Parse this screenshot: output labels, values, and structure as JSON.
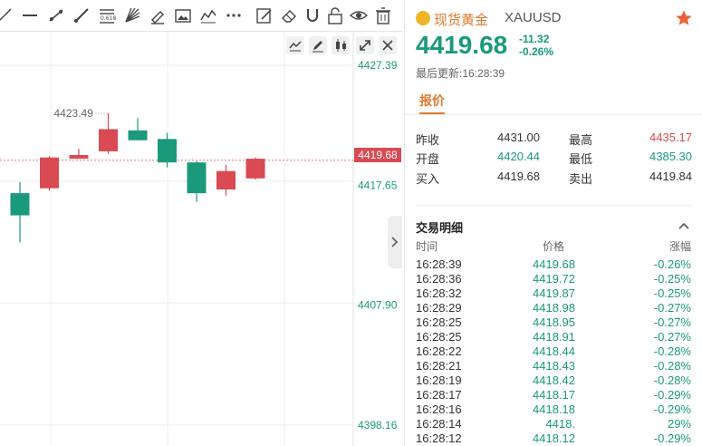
{
  "chart": {
    "price_axis": [
      "4427.39",
      "4417.65",
      "4407.90",
      "4398.16"
    ],
    "current_price_tag": "4419.68",
    "high_marker": "4423.49",
    "candles": [
      {
        "o": 4417.0,
        "h": 4417.9,
        "l": 4413.0,
        "c": 4415.2,
        "dir": "down"
      },
      {
        "o": 4417.4,
        "h": 4420.0,
        "l": 4417.2,
        "c": 4419.9,
        "dir": "up"
      },
      {
        "o": 4420.1,
        "h": 4420.6,
        "l": 4419.8,
        "c": 4419.8,
        "dir": "up"
      },
      {
        "o": 4420.4,
        "h": 4423.5,
        "l": 4420.2,
        "c": 4422.2,
        "dir": "up"
      },
      {
        "o": 4422.1,
        "h": 4423.1,
        "l": 4421.3,
        "c": 4421.3,
        "dir": "down"
      },
      {
        "o": 4421.4,
        "h": 4421.9,
        "l": 4419.1,
        "c": 4419.5,
        "dir": "down"
      },
      {
        "o": 4419.5,
        "h": 4419.6,
        "l": 4416.3,
        "c": 4417.0,
        "dir": "down"
      },
      {
        "o": 4417.3,
        "h": 4419.3,
        "l": 4416.8,
        "c": 4418.8,
        "dir": "up"
      },
      {
        "o": 4418.2,
        "h": 4419.9,
        "l": 4418.1,
        "c": 4419.8,
        "dir": "up"
      }
    ]
  },
  "quote": {
    "symbol_cn": "现货黄金",
    "symbol_code": "XAUUSD",
    "last_price": "4419.68",
    "change_abs": "-11.32",
    "change_pct": "-0.26%",
    "update_time": "最后更新:16:28:39",
    "tab": "报价",
    "stats": {
      "prev_close_label": "昨收",
      "prev_close": "4431.00",
      "high_label": "最高",
      "high": "4435.17",
      "open_label": "开盘",
      "open": "4420.44",
      "low_label": "最低",
      "low": "4385.30",
      "bid_label": "买入",
      "bid": "4419.68",
      "ask_label": "卖出",
      "ask": "4419.84"
    },
    "colors": {
      "up": "#d94a52",
      "down": "#1a9a7a",
      "accent": "#e0782e"
    }
  },
  "trades": {
    "title": "交易明细",
    "headers": [
      "时间",
      "价格",
      "涨幅"
    ],
    "rows": [
      {
        "time": "16:28:39",
        "price": "4419.68",
        "pct": "-0.26%"
      },
      {
        "time": "16:28:36",
        "price": "4419.72",
        "pct": "-0.25%"
      },
      {
        "time": "16:28:32",
        "price": "4419.87",
        "pct": "-0.25%"
      },
      {
        "time": "16:28:29",
        "price": "4418.98",
        "pct": "-0.27%"
      },
      {
        "time": "16:28:25",
        "price": "4418.95",
        "pct": "-0.27%"
      },
      {
        "time": "16:28:25",
        "price": "4418.91",
        "pct": "-0.27%"
      },
      {
        "time": "16:28:22",
        "price": "4418.44",
        "pct": "-0.28%"
      },
      {
        "time": "16:28:21",
        "price": "4418.43",
        "pct": "-0.28%"
      },
      {
        "time": "16:28:19",
        "price": "4418.42",
        "pct": "-0.28%"
      },
      {
        "time": "16:28:17",
        "price": "4418.17",
        "pct": "-0.29%"
      },
      {
        "time": "16:28:16",
        "price": "4418.18",
        "pct": "-0.29%"
      },
      {
        "time": "16:28:14",
        "price": "4418.",
        "pct": "29%"
      },
      {
        "time": "16:28:12",
        "price": "4418.12",
        "pct": "-0.29%"
      }
    ]
  }
}
